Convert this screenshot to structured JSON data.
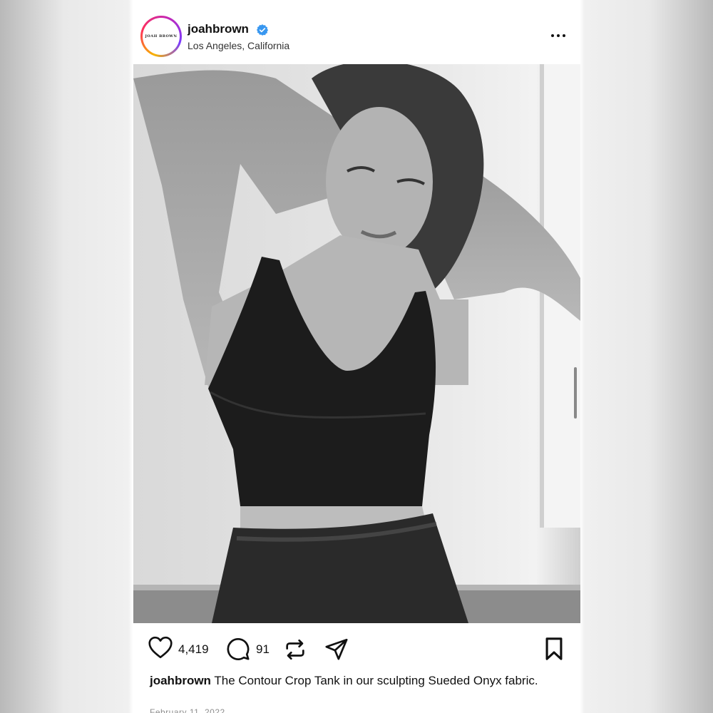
{
  "post": {
    "account": {
      "username": "joahbrown",
      "avatar_text": "JOAH BROWN",
      "verified": true,
      "location": "Los Angeles, California"
    },
    "menu_icon": "more-horizontal-icon",
    "image": {
      "description": "black and white photo of a woman in a black crop tank and sweatpants"
    },
    "actions": {
      "like_icon": "heart-icon",
      "likes": "4,419",
      "comment_icon": "comment-icon",
      "comments": "91",
      "repost_icon": "repost-icon",
      "share_icon": "send-icon",
      "save_icon": "bookmark-icon"
    },
    "caption": {
      "username": "joahbrown",
      "text": "The Contour Crop Tank in our sculpting Sueded Onyx fabric."
    },
    "date": "February 11, 2022"
  },
  "colors": {
    "verified": "#3897f0",
    "text": "#111111",
    "muted": "#8e8e8e"
  }
}
